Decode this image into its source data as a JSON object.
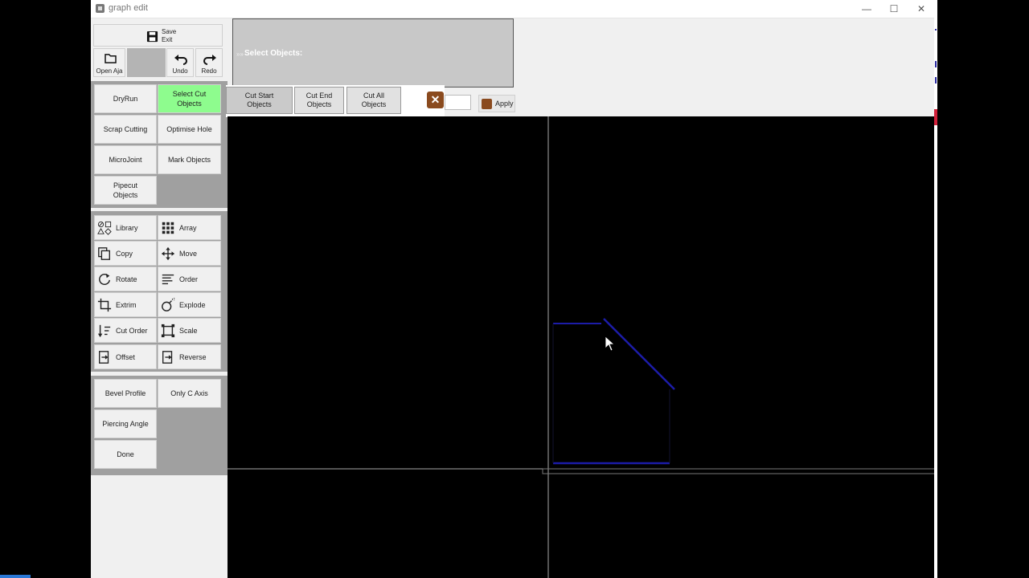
{
  "window": {
    "title": "graph edit",
    "minimize": "—",
    "maximize": "☐",
    "close": "✕"
  },
  "toolbar": {
    "save_label": "Save",
    "exit_label": "Exit",
    "open_label": "Open Aja",
    "undo_label": "Undo",
    "redo_label": "Redo"
  },
  "mode_buttons": {
    "dryrun": "DryRun",
    "select_cut_objects": "Select Cut Objects",
    "scrap_cutting": "Scrap Cutting",
    "optimise_hole": "Optimise Hole",
    "microjoint": "MicroJoint",
    "mark_objects": "Mark Objects",
    "pipecut_objects": "Pipecut Objects"
  },
  "tools": {
    "library": "Library",
    "array": "Array",
    "copy": "Copy",
    "move": "Move",
    "rotate": "Rotate",
    "order": "Order",
    "extrim": "Extrim",
    "explode": "Explode",
    "cut_order": "Cut Order",
    "scale": "Scale",
    "offset": "Offset",
    "reverse": "Reverse"
  },
  "bottom_buttons": {
    "bevel_profile": "Bevel Profile",
    "only_c_axis": "Only C Axis",
    "piercing_angle": "Piercing Angle",
    "done": "Done"
  },
  "select_panel": {
    "arrows": "»»",
    "prompt": "Select Objects:"
  },
  "tabs": {
    "cut_start": "Cut Start Objects",
    "cut_end": "Cut End Objects",
    "cut_all": "Cut All Objects"
  },
  "apply_label": "Apply",
  "colors": {
    "green_active": "#8efc8e",
    "panel_gray": "#a0a0a0",
    "canvas_bg": "#000000",
    "shape_stroke": "#1c1ca8",
    "axis_line": "#a8a8a8",
    "icon_brown": "#8a4a1e"
  }
}
